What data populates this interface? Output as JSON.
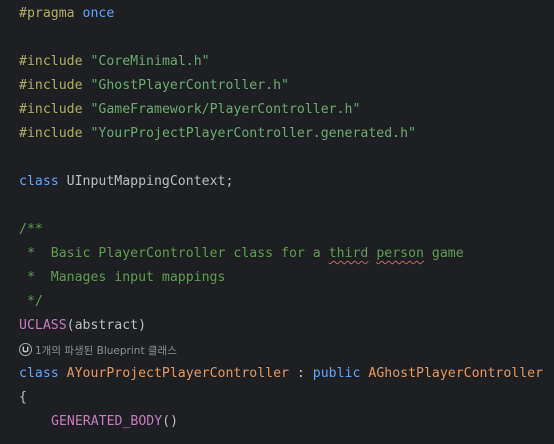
{
  "code": {
    "l1": {
      "pre": "#pragma",
      "rest": "once"
    },
    "l3": {
      "pre": "#include",
      "str": "\"CoreMinimal.h\""
    },
    "l4": {
      "pre": "#include",
      "str": "\"GhostPlayerController.h\""
    },
    "l5": {
      "pre": "#include",
      "str": "\"GameFramework/PlayerController.h\""
    },
    "l6": {
      "pre": "#include",
      "str": "\"YourProjectPlayerController.generated.h\""
    },
    "l8": {
      "kw": "class",
      "name": "UInputMappingContext",
      "punct": ";"
    },
    "l10": {
      "text": "/**"
    },
    "l11": {
      "prefix": " *  Basic PlayerController class for a ",
      "w1": "third",
      "sp": " ",
      "w2": "person",
      "suffix": " game"
    },
    "l12": {
      "text": " *  Manages input mappings"
    },
    "l13": {
      "text": " */"
    },
    "l14": {
      "macro": "UCLASS",
      "open": "(",
      "arg": "abstract",
      "close": ")"
    },
    "hint": "1개의 파생된 Blueprint 클래스",
    "l15": {
      "kw": "class",
      "name": "AYourProjectPlayerController",
      "colon": " : ",
      "kw2": "public",
      "base": "AGhostPlayerController"
    },
    "l16": {
      "text": "{"
    },
    "l17": {
      "macro": "GENERATED_BODY",
      "parens": "()"
    }
  },
  "icons": {
    "hint_icon": "unreal-blueprint-icon"
  }
}
